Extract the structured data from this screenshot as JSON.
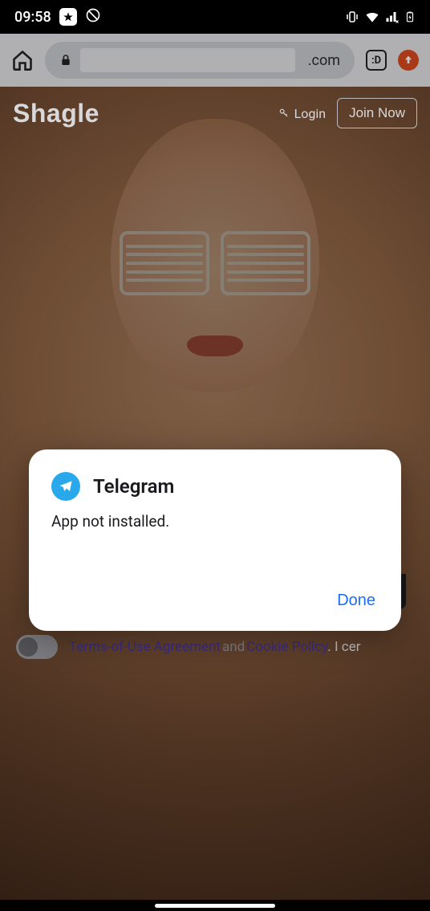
{
  "status": {
    "time": "09:58"
  },
  "browser": {
    "url_suffix": ".com",
    "tab_count": ":D"
  },
  "site": {
    "brand": "Shagle",
    "login_label": "Login",
    "join_label": "Join Now"
  },
  "consent": {
    "terms_label": "Terms-of-Use Agreement",
    "and_label": "and",
    "cookie_label": "Cookie Policy",
    "tail": ". I cer"
  },
  "dialog": {
    "app_name": "Telegram",
    "message": "App not installed.",
    "done_label": "Done"
  }
}
